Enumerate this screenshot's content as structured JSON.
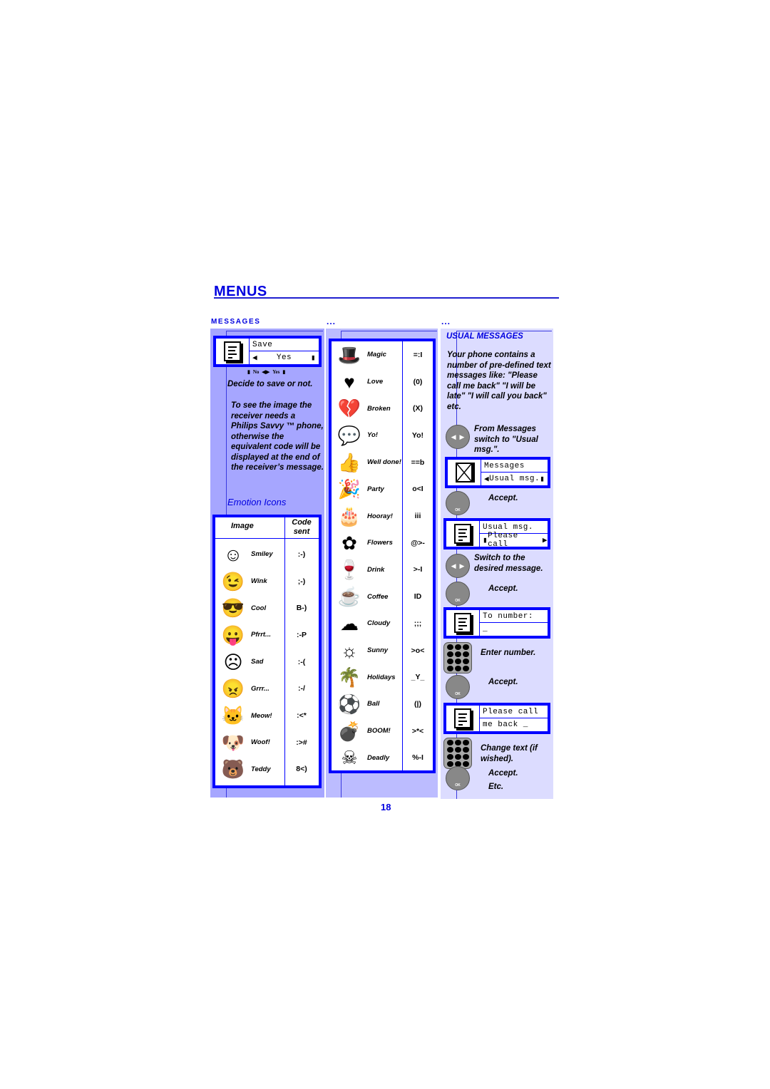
{
  "page": {
    "title": "Menus",
    "section": "Messages",
    "continuation_marks": [
      "...",
      "..."
    ],
    "page_number": "18"
  },
  "column1": {
    "save_screen": {
      "line1": "Save",
      "line2": "Yes",
      "left_arrow": "◀",
      "cursor": "▮"
    },
    "softkey_hint": {
      "left_mark": "▮",
      "no": "No",
      "arrows": "◀▶",
      "yes": "Yes",
      "right_mark": "▮"
    },
    "decide_text": "Decide to save or not.",
    "note": "To see the image the receiver needs a Philips Savvy ™ phone, otherwise the equivalent code will be displayed at the end of the receiver’s message.",
    "emotion_heading": "Emotion Icons",
    "table_headers": {
      "image": "Image",
      "code_line1": "Code",
      "code_line2": "sent"
    },
    "icons": [
      {
        "icon": "smiley-face-icon",
        "glyph": "☺",
        "name": "Smiley",
        "code": ":-)"
      },
      {
        "icon": "wink-face-icon",
        "glyph": "😉",
        "name": "Wink",
        "code": ";-)"
      },
      {
        "icon": "cool-face-icon",
        "glyph": "😎",
        "name": "Cool",
        "code": "B-)"
      },
      {
        "icon": "tongue-face-icon",
        "glyph": "😛",
        "name": "Pfrrt...",
        "code": ":-P"
      },
      {
        "icon": "sad-face-icon",
        "glyph": "☹",
        "name": "Sad",
        "code": ":-("
      },
      {
        "icon": "angry-face-icon",
        "glyph": "😠",
        "name": "Grrr...",
        "code": ":-/"
      },
      {
        "icon": "cat-face-icon",
        "glyph": "🐱",
        "name": "Meow!",
        "code": ":<*"
      },
      {
        "icon": "dog-face-icon",
        "glyph": "🐶",
        "name": "Woof!",
        "code": ":>#"
      },
      {
        "icon": "teddy-bear-icon",
        "glyph": "🐻",
        "name": "Teddy",
        "code": "8<)"
      }
    ]
  },
  "column2": {
    "icons": [
      {
        "icon": "magic-hat-icon",
        "glyph": "🎩",
        "name": "Magic",
        "code": "=:I"
      },
      {
        "icon": "heart-icon",
        "glyph": "♥",
        "name": "Love",
        "code": "(0)"
      },
      {
        "icon": "broken-heart-icon",
        "glyph": "💔",
        "name": "Broken",
        "code": "(X)"
      },
      {
        "icon": "yo-speech-bubble-icon",
        "glyph": "💬",
        "name": "Yo!",
        "code": "Yo!"
      },
      {
        "icon": "thumbs-up-icon",
        "glyph": "👍",
        "name": "Well done!",
        "code": "==b"
      },
      {
        "icon": "party-hat-icon",
        "glyph": "🎉",
        "name": "Party",
        "code": "o<I"
      },
      {
        "icon": "cake-icon",
        "glyph": "🎂",
        "name": "Hooray!",
        "code": "iii"
      },
      {
        "icon": "flowers-icon",
        "glyph": "✿",
        "name": "Flowers",
        "code": "@>-"
      },
      {
        "icon": "drink-icon",
        "glyph": "🍷",
        "name": "Drink",
        "code": ">-I"
      },
      {
        "icon": "coffee-cup-icon",
        "glyph": "☕",
        "name": "Coffee",
        "code": "ID"
      },
      {
        "icon": "cloud-icon",
        "glyph": "☁",
        "name": "Cloudy",
        "code": ";;;"
      },
      {
        "icon": "sun-icon",
        "glyph": "☼",
        "name": "Sunny",
        "code": ">o<"
      },
      {
        "icon": "palm-island-icon",
        "glyph": "🌴",
        "name": "Holidays",
        "code": "_Y_"
      },
      {
        "icon": "ball-icon",
        "glyph": "⚽",
        "name": "Ball",
        "code": "(|)"
      },
      {
        "icon": "bomb-icon",
        "glyph": "💣",
        "name": "BOOM!",
        "code": ">*<"
      },
      {
        "icon": "skull-crossbones-icon",
        "glyph": "☠",
        "name": "Deadly",
        "code": "%-I"
      }
    ]
  },
  "column3": {
    "heading": "Usual Messages",
    "intro": "Your phone contains a number of pre-defined text messages like: \"Please call me back\" \"I will be late\" \"I will call you back\" etc.",
    "steps": [
      {
        "type": "nav-key",
        "text": "From Messages switch to \"Usual msg.\"."
      },
      {
        "type": "screen",
        "line1": "Messages",
        "line2": "Usual msg.",
        "prefix": "◀",
        "suffix": "▮"
      },
      {
        "type": "ok-key",
        "text": "Accept.",
        "key_label": "OK"
      },
      {
        "type": "screen",
        "line1": "Usual msg.",
        "line2": "Please call",
        "prefix": "▮",
        "suffix": "▶"
      },
      {
        "type": "nav-key",
        "text": "Switch to the desired message."
      },
      {
        "type": "ok-key",
        "text": "Accept.",
        "key_label": "OK"
      },
      {
        "type": "screen",
        "line1": "To number:",
        "line2": "_"
      },
      {
        "type": "keypad",
        "text": "Enter number."
      },
      {
        "type": "ok-key",
        "text": "Accept.",
        "key_label": "OK"
      },
      {
        "type": "screen",
        "line1": "Please call",
        "line2": "me back _"
      },
      {
        "type": "keypad",
        "text": "Change text (if wished)."
      },
      {
        "type": "ok-key",
        "text": "Accept.",
        "key_label": "OK"
      },
      {
        "type": "text",
        "text": "Etc."
      }
    ]
  }
}
